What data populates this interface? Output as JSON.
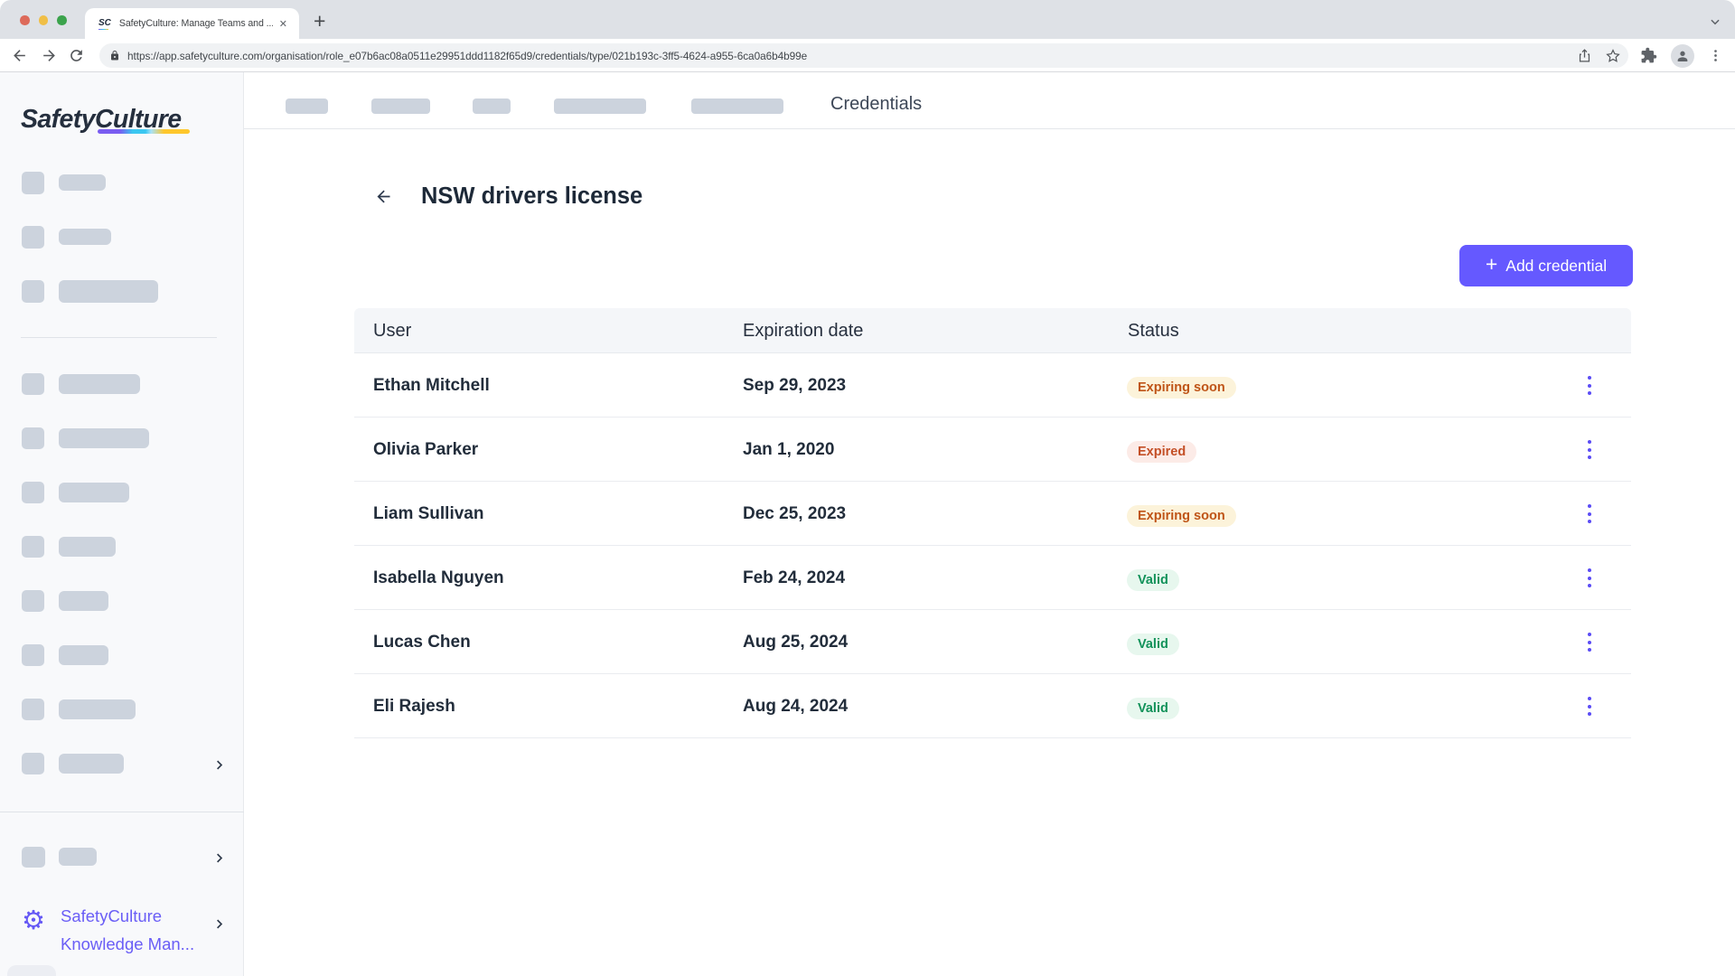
{
  "browser": {
    "tab": {
      "favicon": "SC",
      "title": "SafetyCulture: Manage Teams and ...",
      "close": "✕"
    },
    "new_tab": "+",
    "url": "https://app.safetyculture.com/organisation/role_e07b6ac08a0511e29951ddd1182f65d9/credentials/type/021b193c-3ff5-4624-a955-6ca0a6b4b99e"
  },
  "sidebar": {
    "logo": {
      "part1": "Safety",
      "part2": "Culture"
    },
    "kb_link": {
      "line1": "SafetyCulture",
      "line2": "Knowledge Man..."
    }
  },
  "topnav": {
    "active": "Credentials"
  },
  "content": {
    "title": "NSW drivers license",
    "add_button": {
      "plus": "+",
      "label": "Add credential"
    }
  },
  "table": {
    "columns": [
      "User",
      "Expiration date",
      "Status"
    ],
    "rows": [
      {
        "user": "Ethan Mitchell",
        "expiration": "Sep 29, 2023",
        "status": "Expiring soon",
        "status_kind": "warning"
      },
      {
        "user": "Olivia Parker",
        "expiration": "Jan 1, 2020",
        "status": "Expired",
        "status_kind": "danger"
      },
      {
        "user": "Liam Sullivan",
        "expiration": "Dec 25, 2023",
        "status": "Expiring soon",
        "status_kind": "warning"
      },
      {
        "user": "Isabella Nguyen",
        "expiration": "Feb 24, 2024",
        "status": "Valid",
        "status_kind": "success"
      },
      {
        "user": "Lucas Chen",
        "expiration": "Aug 25, 2024",
        "status": "Valid",
        "status_kind": "success"
      },
      {
        "user": "Eli Rajesh",
        "expiration": "Aug 24, 2024",
        "status": "Valid",
        "status_kind": "success"
      }
    ]
  },
  "colors": {
    "accent": "#6559ff",
    "grad1": "#7a5df1",
    "grad2": "#3bc7f1",
    "grad3": "#fec72c",
    "traffic_red": "#dd6a5a",
    "traffic_yellow": "#f0bf47",
    "traffic_green": "#3ba34c",
    "warning_bg": "#fcf3da",
    "warning_text": "#bf5417",
    "danger_bg": "#fcebe7",
    "danger_text": "#c44f26",
    "success_bg": "#e7f7ee",
    "success_text": "#12925a"
  }
}
